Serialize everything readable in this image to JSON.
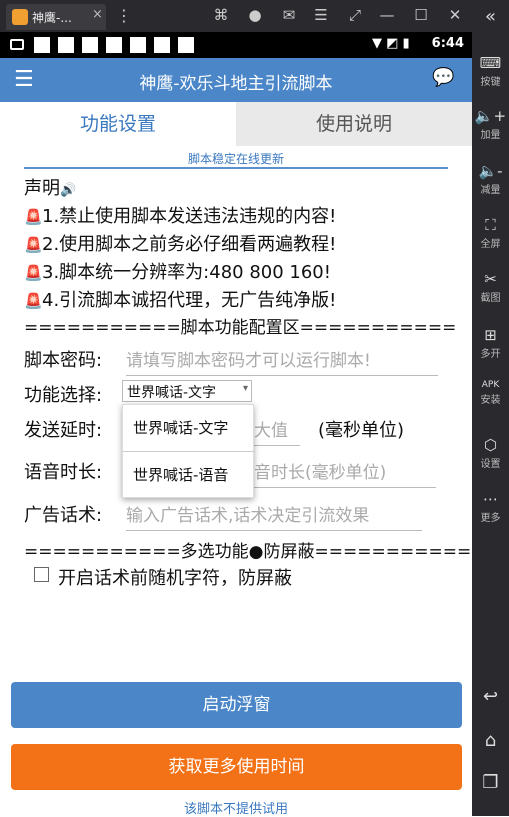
{
  "emulator": {
    "tab_title": "神鹰-...",
    "tab_close": "×",
    "menu": "⋮",
    "collapse": "«",
    "toolbar_icons": [
      "gamepad-icon",
      "user-icon",
      "mail-icon",
      "menu-icon",
      "resize-icon",
      "minimize-icon",
      "maximize-icon",
      "close-icon"
    ],
    "side": [
      {
        "icon": "keyboard-icon",
        "label": "按键"
      },
      {
        "icon": "volume-up-icon",
        "label": "加量"
      },
      {
        "icon": "volume-down-icon",
        "label": "减量"
      },
      {
        "icon": "fullscreen-icon",
        "label": "全屏"
      },
      {
        "icon": "scissors-icon",
        "label": "截图"
      },
      {
        "icon": "multi-open-icon",
        "label": "多开"
      },
      {
        "icon": "apk-icon",
        "label": "安装"
      },
      {
        "icon": "settings-icon",
        "label": "设置"
      },
      {
        "icon": "more-icon",
        "label": "更多"
      }
    ]
  },
  "status_bar": {
    "time": "6:44"
  },
  "app_bar": {
    "title": "神鹰-欢乐斗地主引流脚本"
  },
  "tabs": {
    "settings": "功能设置",
    "instructions": "使用说明"
  },
  "update_note": "脚本稳定在线更新",
  "statement": {
    "title": "声明",
    "lines": [
      "1.禁止使用脚本发送违法违规的内容!",
      "2.使用脚本之前务必仔细看两遍教程!",
      "3.脚本统一分辨率为:480  800  160!",
      "4.引流脚本诚招代理，无广告纯净版!"
    ]
  },
  "config_divider": "===========脚本功能配置区===========",
  "form": {
    "password_label": "脚本密码:",
    "password_placeholder": "请填写脚本密码才可以运行脚本!",
    "function_label": "功能选择:",
    "function_selected": "世界喊话-文字",
    "delay_label": "发送延时:",
    "delay_placeholder": "大值",
    "delay_unit": "(毫秒单位)",
    "voice_label": "语音时长:",
    "voice_placeholder": "音时长(毫秒单位)",
    "ad_label": "广告话术:",
    "ad_placeholder": "输入广告话术,话术决定引流效果"
  },
  "dropdown_options": [
    "世界喊话-文字",
    "世界喊话-语音"
  ],
  "multi_divider": "===========多选功能●防屏蔽===========",
  "checkbox_label": "开启话术前随机字符，防屏蔽",
  "buttons": {
    "start": "启动浮窗",
    "more_time": "获取更多使用时间"
  },
  "footer_note": "该脚本不提供试用",
  "colors": {
    "primary": "#4a86c8",
    "orange": "#f37217",
    "warning": "#e22233"
  }
}
